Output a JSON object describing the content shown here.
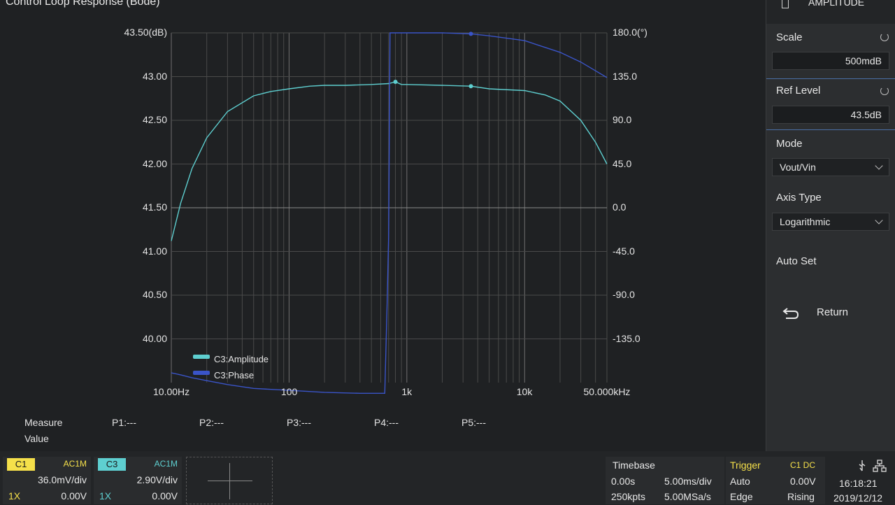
{
  "window": {
    "title": "Control Loop Response (Bode)"
  },
  "panel": {
    "header": "AMPLITUDE",
    "header_icon": "document-icon",
    "scale": {
      "label": "Scale",
      "value": "500mdB"
    },
    "ref_level": {
      "label": "Ref Level",
      "value": "43.5dB"
    },
    "mode": {
      "label": "Mode",
      "value": "Vout/Vin"
    },
    "axis_type": {
      "label": "Axis Type",
      "value": "Logarithmic"
    },
    "auto_set": {
      "label": "Auto Set"
    },
    "return": {
      "label": "Return"
    }
  },
  "chart_data": {
    "type": "line",
    "x_scale": "log",
    "xlim": [
      10,
      50000
    ],
    "x_ticks": [
      {
        "value": 10,
        "label": "10.00Hz"
      },
      {
        "value": 100,
        "label": "100"
      },
      {
        "value": 1000,
        "label": "1k"
      },
      {
        "value": 10000,
        "label": "10k"
      },
      {
        "value": 50000,
        "label": "50.000kHz"
      }
    ],
    "y_left": {
      "ylim": [
        39.5,
        43.5
      ],
      "ticks": [
        "43.50(dB)",
        "43.00",
        "42.50",
        "42.00",
        "41.50",
        "41.00",
        "40.50",
        "40.00"
      ],
      "tick_values": [
        43.5,
        43.0,
        42.5,
        42.0,
        41.5,
        41.0,
        40.5,
        40.0
      ]
    },
    "y_right": {
      "ylim": [
        -180,
        180
      ],
      "ticks": [
        "180.0(°)",
        "135.0",
        "90.0",
        "45.0",
        "0.0",
        "-45.0",
        "-90.0",
        "-135.0"
      ],
      "tick_values": [
        180,
        135,
        90,
        45,
        0,
        -45,
        -90,
        -135
      ]
    },
    "grid": true,
    "legend_position": "bottom-left",
    "series": [
      {
        "name": "C3:Amplitude",
        "axis": "left",
        "color": "#5ecfd0",
        "points": [
          [
            10,
            41.12
          ],
          [
            12,
            41.55
          ],
          [
            15,
            41.95
          ],
          [
            20,
            42.3
          ],
          [
            30,
            42.6
          ],
          [
            50,
            42.78
          ],
          [
            70,
            42.83
          ],
          [
            100,
            42.86
          ],
          [
            150,
            42.89
          ],
          [
            200,
            42.9
          ],
          [
            300,
            42.9
          ],
          [
            500,
            42.91
          ],
          [
            700,
            42.92
          ],
          [
            800,
            42.94
          ],
          [
            900,
            42.91
          ],
          [
            1000,
            42.91
          ],
          [
            2000,
            42.9
          ],
          [
            3500,
            42.89
          ],
          [
            5000,
            42.86
          ],
          [
            10000,
            42.84
          ],
          [
            15000,
            42.79
          ],
          [
            20000,
            42.72
          ],
          [
            30000,
            42.5
          ],
          [
            40000,
            42.25
          ],
          [
            50000,
            42.0
          ]
        ],
        "markers": [
          [
            800,
            42.94
          ],
          [
            3500,
            42.89
          ]
        ]
      },
      {
        "name": "C3:Phase",
        "axis": "right",
        "color": "#3a54c8",
        "points": [
          [
            10,
            -170
          ],
          [
            12,
            -172
          ],
          [
            15,
            -175
          ],
          [
            20,
            -178
          ],
          [
            30,
            -182
          ],
          [
            50,
            -186
          ],
          [
            100,
            -188
          ],
          [
            200,
            -190
          ],
          [
            400,
            -191
          ],
          [
            600,
            -191
          ],
          [
            650,
            -191
          ],
          [
            680,
            -100
          ],
          [
            700,
            -30
          ],
          [
            720,
            180
          ],
          [
            800,
            180
          ],
          [
            1000,
            180
          ],
          [
            2000,
            180
          ],
          [
            3500,
            179
          ],
          [
            5000,
            177
          ],
          [
            10000,
            172
          ],
          [
            20000,
            160
          ],
          [
            30000,
            150
          ],
          [
            40000,
            141
          ],
          [
            50000,
            134
          ]
        ],
        "markers": [
          [
            3500,
            179
          ]
        ]
      }
    ]
  },
  "measure": {
    "label_measure": "Measure",
    "label_value": "Value",
    "points": [
      "P1:---",
      "P2:---",
      "P3:---",
      "P4:---",
      "P5:---"
    ]
  },
  "channels": [
    {
      "name": "C1",
      "coupling": "AC1M",
      "vdiv": "36.0mV/div",
      "probe": "1X",
      "offset": "0.00V",
      "color": "#f5e04a"
    },
    {
      "name": "C3",
      "coupling": "AC1M",
      "vdiv": "2.90V/div",
      "probe": "1X",
      "offset": "0.00V",
      "color": "#5ecfd0"
    }
  ],
  "timebase": {
    "label": "Timebase",
    "delay": "0.00s",
    "tdiv": "5.00ms/div",
    "points": "250kpts",
    "rate": "5.00MSa/s"
  },
  "trigger": {
    "label": "Trigger",
    "source": "C1 DC",
    "mode": "Auto",
    "level": "0.00V",
    "type": "Edge",
    "slope": "Rising"
  },
  "clock": {
    "time": "16:18:21",
    "date": "2019/12/12"
  },
  "icons": [
    "usb-icon",
    "network-icon"
  ]
}
